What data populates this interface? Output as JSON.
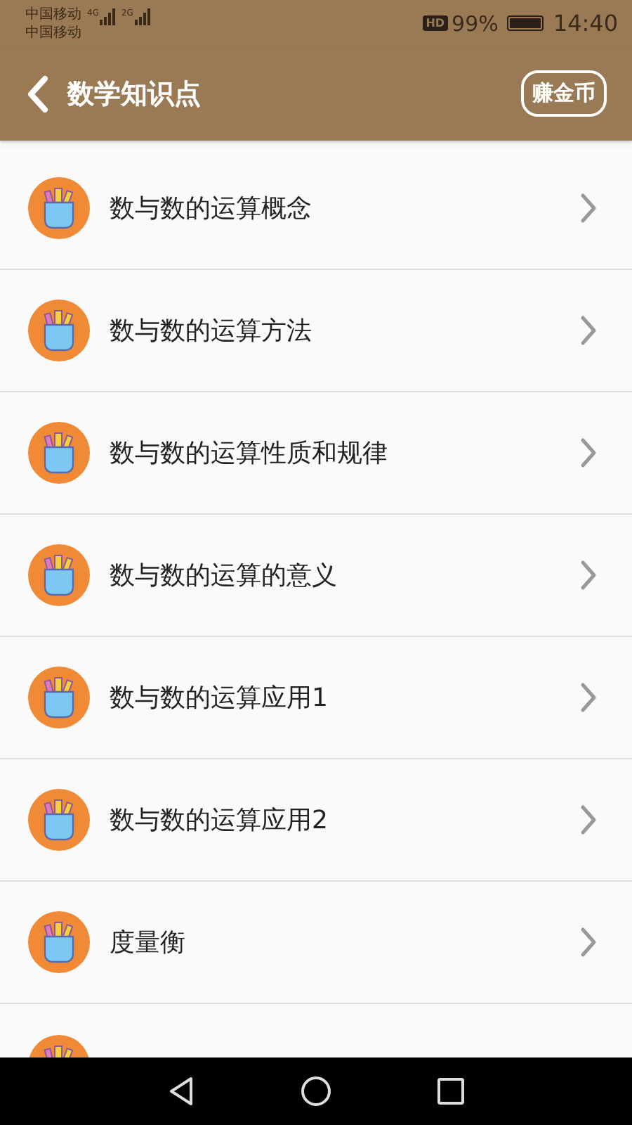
{
  "status_bar": {
    "carriers": [
      "中国移动",
      "中国移动"
    ],
    "networks": [
      "4G",
      "2G"
    ],
    "hd": "HD",
    "battery": "99%",
    "time": "14:40"
  },
  "header": {
    "title": "数学知识点",
    "action": "赚金币"
  },
  "items": [
    {
      "kind": "row",
      "title": "数与数的运算概念"
    },
    {
      "kind": "row",
      "title": "数与数的运算方法"
    },
    {
      "kind": "row",
      "title": "数与数的运算性质和规律"
    },
    {
      "kind": "row",
      "title": "数与数的运算的意义"
    },
    {
      "kind": "row",
      "title": "数与数的运算应用1"
    },
    {
      "kind": "row",
      "title": "数与数的运算应用2"
    },
    {
      "kind": "row",
      "title": "度量衡"
    },
    {
      "kind": "partial"
    }
  ]
}
